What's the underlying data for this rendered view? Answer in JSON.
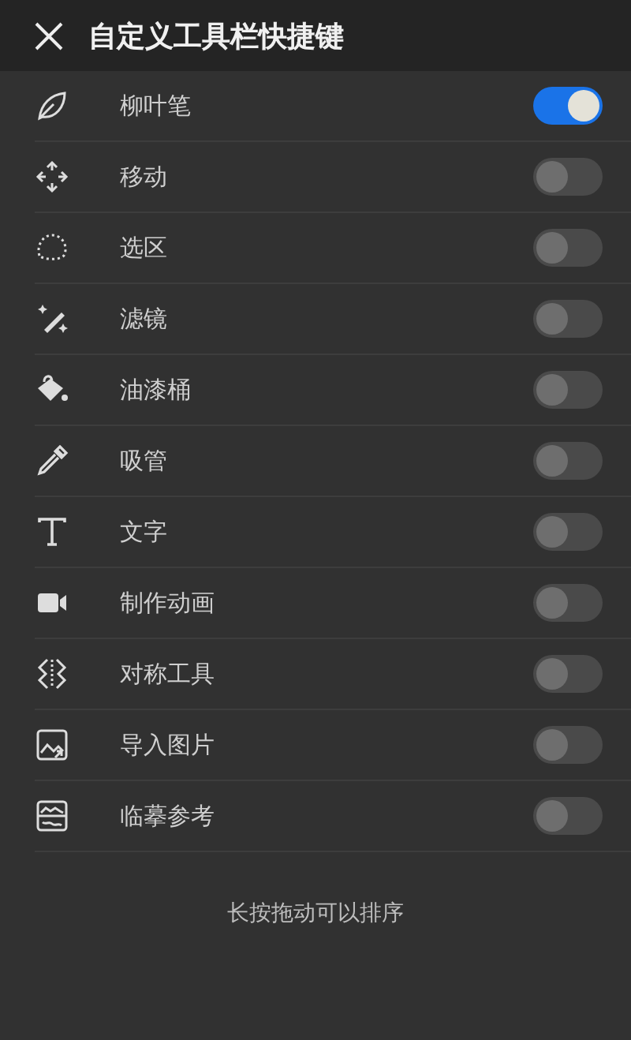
{
  "header": {
    "title": "自定义工具栏快捷键"
  },
  "tools": [
    {
      "label": "柳叶笔",
      "on": true
    },
    {
      "label": "移动",
      "on": false
    },
    {
      "label": "选区",
      "on": false
    },
    {
      "label": "滤镜",
      "on": false
    },
    {
      "label": "油漆桶",
      "on": false
    },
    {
      "label": "吸管",
      "on": false
    },
    {
      "label": "文字",
      "on": false
    },
    {
      "label": "制作动画",
      "on": false
    },
    {
      "label": "对称工具",
      "on": false
    },
    {
      "label": "导入图片",
      "on": false
    },
    {
      "label": "临摹参考",
      "on": false
    }
  ],
  "hint": "长按拖动可以排序"
}
